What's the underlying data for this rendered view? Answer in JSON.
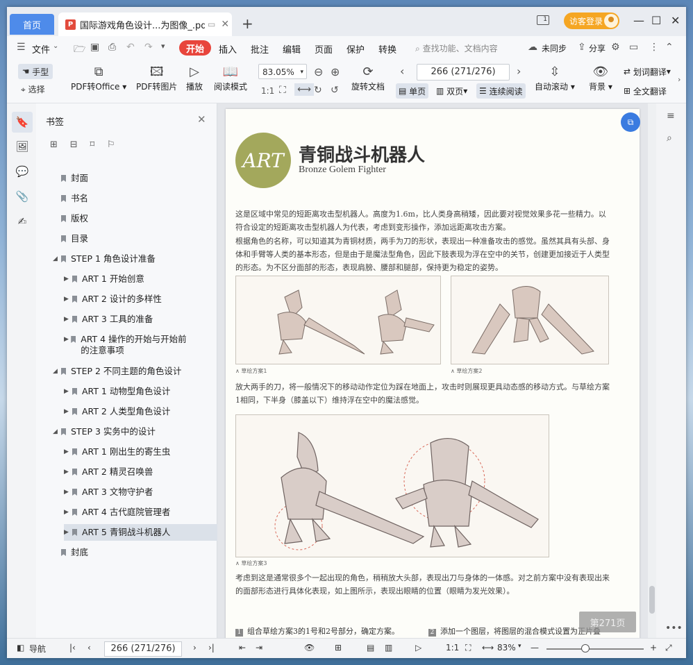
{
  "titlebar": {
    "home_tab": "首页",
    "doc_tab_title": "国际游戏角色设计...为图像_.pdf",
    "new_tab": "+",
    "login_label": "访客登录"
  },
  "menu": {
    "file": "文件",
    "start": "开始",
    "items": [
      "插入",
      "批注",
      "编辑",
      "页面",
      "保护",
      "转换"
    ],
    "search_placeholder": "查找功能、文档内容",
    "unsync": "未同步",
    "share": "分享"
  },
  "toolbar": {
    "hand": "手型",
    "select": "选择",
    "pdf_to_office": "PDF转Office",
    "pdf_to_image": "PDF转图片",
    "play": "播放",
    "reading_mode": "阅读模式",
    "zoom": "83.05%",
    "rotate_doc": "旋转文档",
    "page_display": "266 (271/276)",
    "single_page": "单页",
    "double_page": "双页",
    "continuous": "连续阅读",
    "auto_scroll": "自动滚动",
    "background": "背景",
    "word_translate": "划词翻译",
    "full_translate": "全文翻译"
  },
  "bookmarks": {
    "title": "书签",
    "items": [
      {
        "label": "封面",
        "level": 0,
        "arrow": ""
      },
      {
        "label": "书名",
        "level": 0,
        "arrow": ""
      },
      {
        "label": "版权",
        "level": 0,
        "arrow": ""
      },
      {
        "label": "目录",
        "level": 0,
        "arrow": ""
      },
      {
        "label": "STEP 1 角色设计准备",
        "level": 0,
        "arrow": "◢"
      },
      {
        "label": "ART 1 开始创意",
        "level": 1,
        "arrow": "▶"
      },
      {
        "label": "ART 2 设计的多样性",
        "level": 1,
        "arrow": "▶"
      },
      {
        "label": "ART 3 工具的准备",
        "level": 1,
        "arrow": "▶"
      },
      {
        "label": "ART 4 操作的开始与开始前的注意事项",
        "level": 1,
        "arrow": "▶"
      },
      {
        "label": "STEP 2 不同主题的角色设计",
        "level": 0,
        "arrow": "◢"
      },
      {
        "label": "ART 1 动物型角色设计",
        "level": 1,
        "arrow": "▶"
      },
      {
        "label": "ART 2 人类型角色设计",
        "level": 1,
        "arrow": "▶"
      },
      {
        "label": "STEP 3 实务中的设计",
        "level": 0,
        "arrow": "◢"
      },
      {
        "label": "ART 1 刚出生的寄生虫",
        "level": 1,
        "arrow": "▶"
      },
      {
        "label": "ART 2 精灵召唤兽",
        "level": 1,
        "arrow": "▶"
      },
      {
        "label": "ART 3 文物守护者",
        "level": 1,
        "arrow": "▶"
      },
      {
        "label": "ART 4 古代庭院管理者",
        "level": 1,
        "arrow": "▶"
      },
      {
        "label": "ART 5 青铜战斗机器人",
        "level": 1,
        "arrow": "▶"
      },
      {
        "label": "封底",
        "level": 0,
        "arrow": ""
      }
    ]
  },
  "page": {
    "art_logo": "ART",
    "title": "青铜战斗机器人",
    "subtitle": "Bronze Golem Fighter",
    "para1": "这是区域中常见的短距离攻击型机器人。高度为1.6m，比人类身高稍矮，因此要对视觉效果多花一些精力。以符合设定的短距离攻击型机器人为代表，考虑到变形操作，添加远距离攻击方案。",
    "para2": "根据角色的名称，可以知道其为青铜材质，两手为刀的形状，表现出一种准备攻击的感觉。虽然其具有头部、身体和手臂等人类的基本形态，但是由于是魔法型角色，因此下肢表现为浮在空中的关节，创建更加接近于人类型的形态。为不区分面部的形态，表现肩膀、腰部和腿部，保持更为稳定的姿势。",
    "caption1": "∧ 草绘方案1",
    "caption2": "∧ 草绘方案2",
    "para3": "放大两手的刀，将一般情况下的移动动作定位为踩在地面上，攻击时则展现更具动态感的移动方式。与草绘方案1相同，下半身（膝盖以下）维持浮在空中的魔法感觉。",
    "caption3": "∧ 草绘方案3",
    "para4": "考虑到这是通常很多个一起出现的角色，稍稍放大头部，表现出刀与身体的一体感。对之前方案中没有表现出来的面部形态进行具体化表现，如上图所示，表现出眼睛的位置（眼睛为发光效果）。",
    "step1_num": "1",
    "step1": "组合草绘方案3的1号和2号部分，确定方案。",
    "step2_num": "2",
    "step2": "添加一个图层，将图层的混合模式设置为正片叠",
    "page_badge": "第271页"
  },
  "status": {
    "nav": "导航",
    "page": "266 (271/276)",
    "zoom": "83%"
  },
  "colors": {
    "accent": "#4e8bea",
    "start_red": "#e8453c",
    "login_orange": "#f5a623",
    "art_olive": "#a3a85c"
  }
}
